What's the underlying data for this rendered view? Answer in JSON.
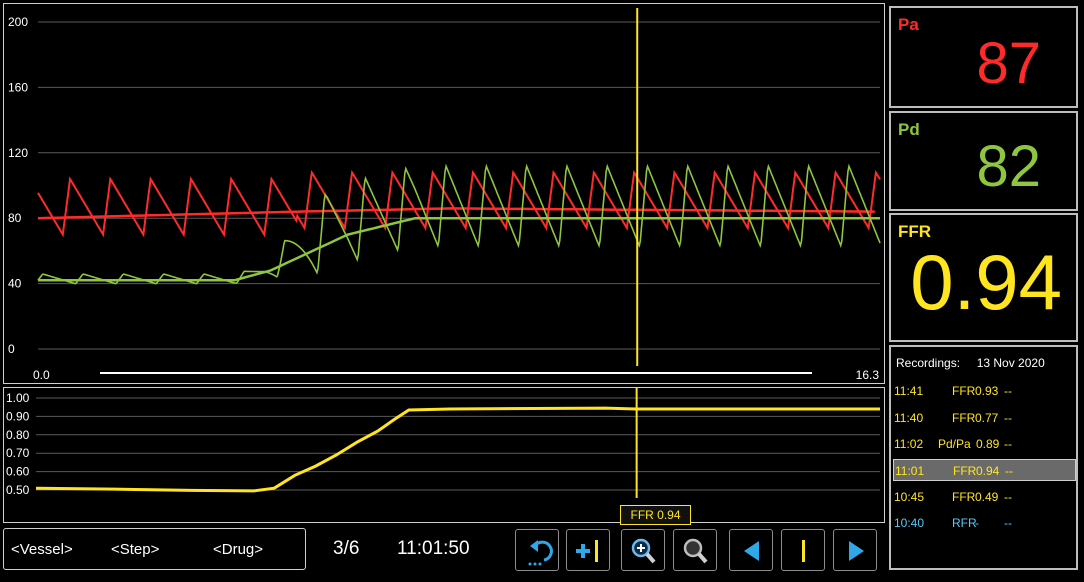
{
  "readouts": {
    "pa": {
      "label": "Pa",
      "value": "87",
      "color": "#ff2b2b"
    },
    "pd": {
      "label": "Pd",
      "value": "82",
      "color": "#8ec63f"
    },
    "ffr": {
      "label": "FFR",
      "value": "0.94",
      "color": "#ffe51f"
    }
  },
  "recordings": {
    "header": "Recordings:",
    "date": "13 Nov 2020",
    "items": [
      {
        "time": "11:41",
        "type": "FFR",
        "value": "0.93",
        "suffix": "--",
        "color": "#ffe51f",
        "selected": false
      },
      {
        "time": "11:40",
        "type": "FFR",
        "value": "0.77",
        "suffix": "--",
        "color": "#ffe51f",
        "selected": false
      },
      {
        "time": "11:02",
        "type": "Pd/Pa",
        "value": "0.89",
        "suffix": "--",
        "color": "#ffe51f",
        "selected": false
      },
      {
        "time": "11:01",
        "type": "FFR",
        "value": "0.94",
        "suffix": "--",
        "color": "#ffe51f",
        "selected": true
      },
      {
        "time": "10:45",
        "type": "FFR",
        "value": "0.49",
        "suffix": "--",
        "color": "#ffe51f",
        "selected": false
      },
      {
        "time": "10:40",
        "type": "RFR",
        "value": "-",
        "suffix": "--",
        "color": "#5bc8f5",
        "selected": false
      }
    ]
  },
  "toolbar": {
    "vessel_label": "<Vessel>",
    "step_label": "<Step>",
    "drug_label": "<Drug>",
    "page_indicator": "3/6",
    "time": "11:01:50",
    "buttons": [
      {
        "name": "undo-button",
        "icon": "undo-arrow-icon"
      },
      {
        "name": "add-marker-button",
        "icon": "plus-marker-icon"
      },
      {
        "name": "zoom-in-button",
        "icon": "zoom-in-icon"
      },
      {
        "name": "zoom-out-button",
        "icon": "zoom-out-icon"
      },
      {
        "name": "previous-button",
        "icon": "triangle-left-icon"
      },
      {
        "name": "marker-button",
        "icon": "marker-line-icon"
      },
      {
        "name": "next-button",
        "icon": "triangle-right-icon"
      }
    ]
  },
  "cursor_tooltip": "FFR 0.94",
  "chart_data": [
    {
      "type": "line",
      "yticks": [
        "200",
        "160",
        "120",
        "80",
        "40",
        "0"
      ],
      "ylim": [
        0,
        200
      ],
      "xlim": [
        0.0,
        16.3
      ],
      "x_range_labels": {
        "start": "0.0",
        "end": "16.3"
      },
      "grid": true,
      "series": [
        {
          "name": "Pa",
          "color": "#ff2b2b",
          "mean": 80,
          "description_points": [
            [
              0.0,
              80
            ],
            [
              5.0,
              84
            ],
            [
              8.0,
              86
            ],
            [
              16.3,
              84
            ]
          ],
          "systolic": 104,
          "diastolic": 70
        },
        {
          "name": "Pd",
          "color": "#8ec63f",
          "mean": 42,
          "description_points": [
            [
              0.0,
              42
            ],
            [
              3.8,
              42
            ],
            [
              4.5,
              48
            ],
            [
              6.0,
              70
            ],
            [
              7.3,
              80
            ],
            [
              16.3,
              80
            ]
          ],
          "systolic": 112,
          "diastolic": 62
        }
      ],
      "cursor_x": 11.6
    },
    {
      "type": "line",
      "yticks": [
        "1.00",
        "0.90",
        "0.80",
        "0.70",
        "0.60",
        "0.50"
      ],
      "ylim": [
        0.48,
        1.02
      ],
      "xlim": [
        0.0,
        16.3
      ],
      "grid": true,
      "series": [
        {
          "name": "FFR",
          "color": "#ffe51f",
          "points": [
            [
              0.0,
              0.51
            ],
            [
              1.5,
              0.505
            ],
            [
              3.0,
              0.498
            ],
            [
              4.2,
              0.495
            ],
            [
              4.6,
              0.51
            ],
            [
              5.0,
              0.58
            ],
            [
              5.4,
              0.63
            ],
            [
              5.8,
              0.69
            ],
            [
              6.2,
              0.76
            ],
            [
              6.6,
              0.82
            ],
            [
              6.9,
              0.88
            ],
            [
              7.2,
              0.935
            ],
            [
              8.0,
              0.94
            ],
            [
              11.0,
              0.945
            ],
            [
              11.6,
              0.94
            ],
            [
              16.3,
              0.94
            ]
          ]
        }
      ],
      "cursor_x": 11.6
    }
  ]
}
